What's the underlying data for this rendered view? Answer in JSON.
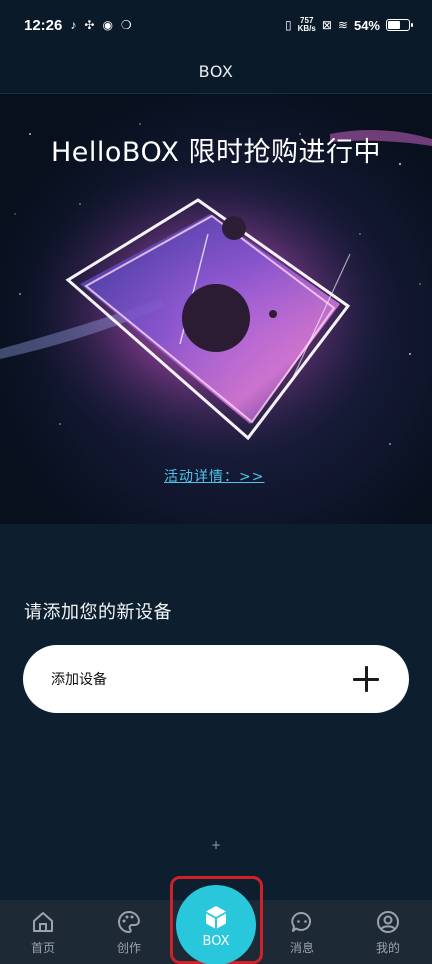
{
  "status_bar": {
    "time": "12:26",
    "net_speed_value": "757",
    "net_speed_unit": "KB/s",
    "battery_percent": "54%",
    "battery_level": 0.54
  },
  "header": {
    "title": "BOX"
  },
  "banner": {
    "title": "HelloBOX 限时抢购进行中",
    "link_text": "活动详情：>>"
  },
  "add_device": {
    "section_title": "请添加您的新设备",
    "card_label": "添加设备"
  },
  "floating_plus": "+",
  "nav": {
    "items": [
      {
        "label": "首页",
        "icon": "home-icon"
      },
      {
        "label": "创作",
        "icon": "palette-icon"
      },
      {
        "label": "BOX",
        "icon": "cube-icon"
      },
      {
        "label": "消息",
        "icon": "chat-icon"
      },
      {
        "label": "我的",
        "icon": "profile-icon"
      }
    ]
  },
  "colors": {
    "background": "#0d1f2e",
    "accent": "#28c7dc",
    "link": "#4ec5e6",
    "highlight_frame": "#d0202a"
  }
}
